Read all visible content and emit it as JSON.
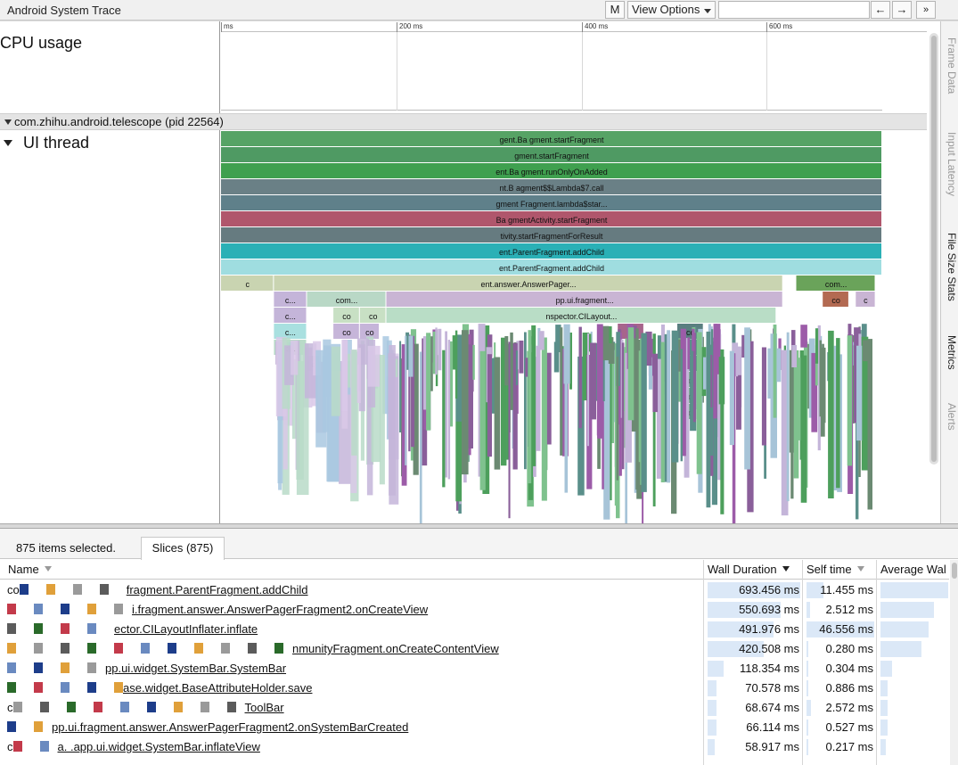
{
  "toolbar": {
    "title": "Android System Trace",
    "m_label": "M",
    "view_options_label": "View Options",
    "prev_label": "←",
    "next_label": "→",
    "more_label": "»",
    "search_value": ""
  },
  "timeline": {
    "ticks": [
      "ms",
      "200 ms",
      "400 ms",
      "600 ms"
    ],
    "cpu_label": "CPU usage",
    "process_label": "com.zhihu.android.telescope (pid 22564)",
    "thread_label": "UI thread"
  },
  "slices": [
    {
      "label": "gent.Ba   gment.startFragment",
      "color": "#56a365",
      "depth": 0,
      "start": 0.0,
      "end": 1.0
    },
    {
      "label": "gment.startFragment",
      "color": "#4f9a63",
      "depth": 1,
      "start": 0.0,
      "end": 1.0
    },
    {
      "label": "ent.Ba   gment.runOnlyOnAdded",
      "color": "#3fa04f",
      "depth": 2,
      "start": 0.0,
      "end": 1.0
    },
    {
      "label": "nt.B   agment$$Lambda$7.call",
      "color": "#6a8086",
      "depth": 3,
      "start": 0.0,
      "end": 1.0
    },
    {
      "label": "gment   Fragment.lambda$star...",
      "color": "#5f808a",
      "depth": 4,
      "start": 0.0,
      "end": 1.0
    },
    {
      "label": "Ba   gmentActivity.startFragment",
      "color": "#b0566c",
      "depth": 5,
      "start": 0.0,
      "end": 1.0
    },
    {
      "label": "tivity.startFragmentForResult",
      "color": "#667b80",
      "depth": 6,
      "start": 0.0,
      "end": 1.0
    },
    {
      "label": "ent.ParentFragment.addChild",
      "color": "#2ab0b6",
      "depth": 7,
      "start": 0.0,
      "end": 1.0
    },
    {
      "label": "ent.ParentFragment.addChild",
      "color": "#9fdde0",
      "depth": 8,
      "start": 0.0,
      "end": 1.0
    },
    {
      "label": "c",
      "color": "#c9d4b1",
      "depth": 9,
      "start": 0.0,
      "end": 0.08
    },
    {
      "label": "ent.answer.AnswerPager...",
      "color": "#c9d4b1",
      "depth": 9,
      "start": 0.08,
      "end": 0.85
    },
    {
      "label": "com...",
      "color": "#6aa35a",
      "depth": 9,
      "start": 0.87,
      "end": 0.99
    },
    {
      "label": "c...",
      "color": "#c4b5d9",
      "depth": 10,
      "start": 0.08,
      "end": 0.13
    },
    {
      "label": "com...",
      "color": "#b9d8c6",
      "depth": 10,
      "start": 0.13,
      "end": 0.25
    },
    {
      "label": "pp.ui.fragment...",
      "color": "#c9b5d4",
      "depth": 10,
      "start": 0.25,
      "end": 0.85
    },
    {
      "label": "co",
      "color": "#b36a52",
      "depth": 10,
      "start": 0.91,
      "end": 0.95
    },
    {
      "label": "c",
      "color": "#c9b5d4",
      "depth": 10,
      "start": 0.96,
      "end": 0.99
    },
    {
      "label": "c...",
      "color": "#c4b5d9",
      "depth": 11,
      "start": 0.08,
      "end": 0.13
    },
    {
      "label": "co",
      "color": "#c8e0c4",
      "depth": 11,
      "start": 0.17,
      "end": 0.21
    },
    {
      "label": "co",
      "color": "#c8e0c4",
      "depth": 11,
      "start": 0.21,
      "end": 0.25
    },
    {
      "label": "nspector.CILayout...",
      "color": "#b9ddc6",
      "depth": 11,
      "start": 0.25,
      "end": 0.84
    },
    {
      "label": "c...",
      "color": "#a9e0e0",
      "depth": 12,
      "start": 0.08,
      "end": 0.13
    },
    {
      "label": "co",
      "color": "#c6b5d9",
      "depth": 12,
      "start": 0.17,
      "end": 0.21
    },
    {
      "label": "co",
      "color": "#c6b5d9",
      "depth": 12,
      "start": 0.21,
      "end": 0.24
    },
    {
      "label": "c",
      "color": "#a7658c",
      "depth": 12,
      "start": 0.6,
      "end": 0.64
    },
    {
      "label": "co",
      "color": "#5a7f80",
      "depth": 12,
      "start": 0.69,
      "end": 0.73
    },
    {
      "label": "c...",
      "color": "#b9dbc8",
      "depth": 13,
      "start": 0.08,
      "end": 0.13
    },
    {
      "label": "co",
      "color": "#5a7f80",
      "depth": 13,
      "start": 0.69,
      "end": 0.73
    },
    {
      "label": "c",
      "color": "#b9dbc8",
      "depth": 14,
      "start": 0.13,
      "end": 0.15
    },
    {
      "label": "co",
      "color": "#5a7f80",
      "depth": 14,
      "start": 0.69,
      "end": 0.73
    },
    {
      "label": "c",
      "color": "#4d9f5c",
      "depth": 15,
      "start": 0.7,
      "end": 0.72
    },
    {
      "label": "c",
      "color": "#4d9f5c",
      "depth": 16,
      "start": 0.7,
      "end": 0.72
    },
    {
      "label": "c",
      "color": "#4d9f5c",
      "depth": 17,
      "start": 0.7,
      "end": 0.72
    }
  ],
  "side_panel": {
    "tabs": [
      "Frame Data",
      "Input Latency",
      "File Size Stats",
      "Metrics",
      "Alerts"
    ]
  },
  "analysis": {
    "selection_text": "875 items selected.",
    "tab_label": "Slices (875)",
    "columns": {
      "name": "Name",
      "wall_duration": "Wall Duration",
      "self_time": "Self time",
      "average_wall": "Average Wal"
    },
    "rows": [
      {
        "name_prefix": "co",
        "name": "fragment.ParentFragment.addChild",
        "wall": "693.456 ms",
        "wall_frac": 1.0,
        "self": "11.455 ms",
        "self_frac": 0.25
      },
      {
        "name_prefix": "",
        "name": "i.fragment.answer.AnswerPagerFragment2.onCreateView",
        "wall": "550.693 ms",
        "wall_frac": 0.79,
        "self": "2.512 ms",
        "self_frac": 0.05
      },
      {
        "name_prefix": "",
        "name": "ector.CILayoutInflater.inflate",
        "wall": "491.976 ms",
        "wall_frac": 0.71,
        "self": "46.556 ms",
        "self_frac": 1.0
      },
      {
        "name_prefix": "",
        "name": "nmunityFragment.onCreateContentView",
        "wall": "420.508 ms",
        "wall_frac": 0.61,
        "self": "0.280 ms",
        "self_frac": 0.01
      },
      {
        "name_prefix": "",
        "name": "pp.ui.widget.SystemBar.SystemBar",
        "wall": "118.354 ms",
        "wall_frac": 0.17,
        "self": "0.304 ms",
        "self_frac": 0.01
      },
      {
        "name_prefix": "",
        "name": "ase.widget.BaseAttributeHolder.save",
        "wall": "70.578 ms",
        "wall_frac": 0.1,
        "self": "0.886 ms",
        "self_frac": 0.02
      },
      {
        "name_prefix": "c",
        "name": "ToolBar",
        "wall": "68.674 ms",
        "wall_frac": 0.1,
        "self": "2.572 ms",
        "self_frac": 0.06
      },
      {
        "name_prefix": "",
        "name": "pp.ui.fragment.answer.AnswerPagerFragment2.onSystemBarCreated",
        "wall": "66.114 ms",
        "wall_frac": 0.1,
        "self": "0.527 ms",
        "self_frac": 0.01
      },
      {
        "name_prefix": "c",
        "name": "a.   .app.ui.widget.SystemBar.inflateView",
        "wall": "58.917 ms",
        "wall_frac": 0.08,
        "self": "0.217 ms",
        "self_frac": 0.0
      }
    ]
  }
}
